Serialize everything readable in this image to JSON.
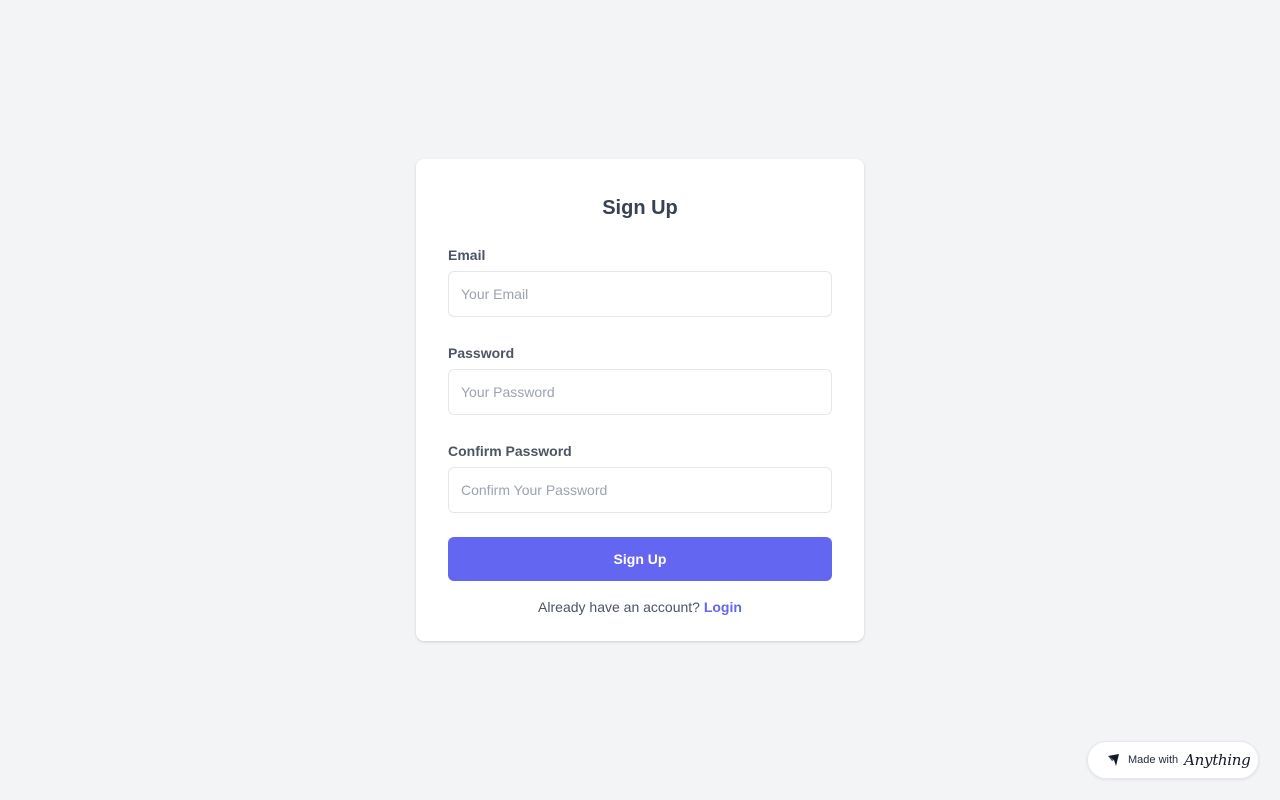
{
  "form": {
    "title": "Sign Up",
    "email": {
      "label": "Email",
      "placeholder": "Your Email"
    },
    "password": {
      "label": "Password",
      "placeholder": "Your Password"
    },
    "confirm_password": {
      "label": "Confirm Password",
      "placeholder": "Confirm Your Password"
    },
    "submit_label": "Sign Up",
    "footer_prompt": "Already have an account? ",
    "login_link": "Login"
  },
  "badge": {
    "text": "Made with",
    "brand": "Anything",
    "icon": "anything-logo-icon"
  },
  "colors": {
    "background": "#f3f4f6",
    "card": "#ffffff",
    "accent": "#6366f1",
    "heading": "#374151",
    "label": "#4b5563",
    "placeholder": "#9ca3af"
  }
}
